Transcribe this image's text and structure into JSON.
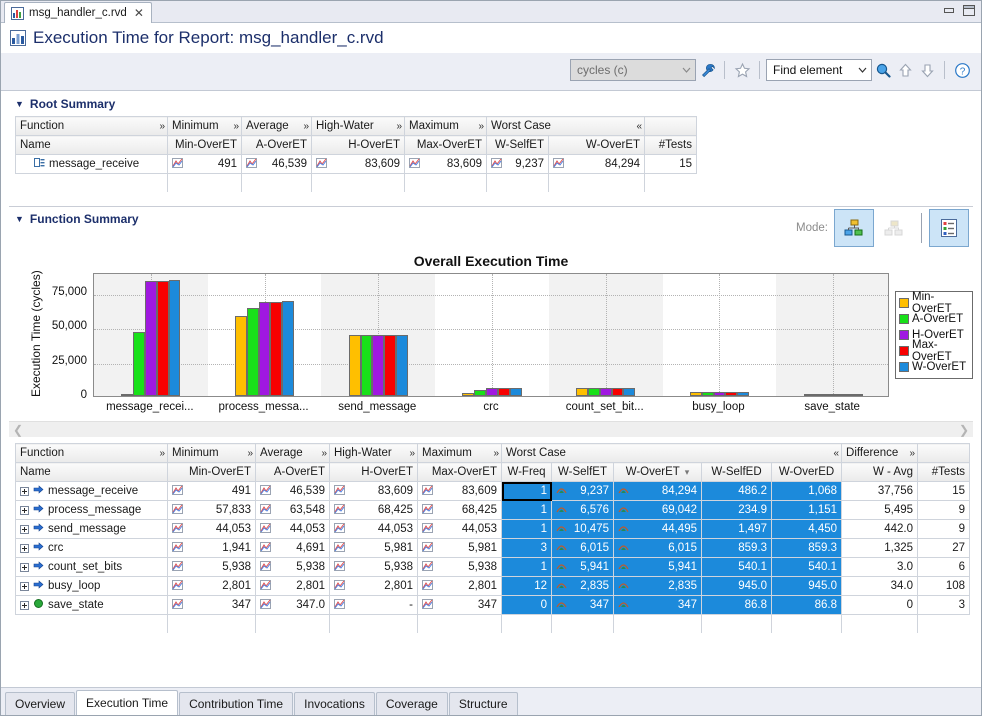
{
  "window": {
    "tab_title": "msg_handler_c.rvd",
    "tab_close": "✕",
    "minimize_label": "minimize",
    "maximize_label": "maximize"
  },
  "header": {
    "title": "Execution Time for Report: msg_handler_c.rvd"
  },
  "toolbar": {
    "units_value": "cycles (c)",
    "units_arrow": "⌄",
    "wrench_icon": "wrench-icon",
    "bookmark_icon": "bookmark-icon",
    "find_value": "Find element",
    "find_arrow": "⌄",
    "find_icon": "magnifier-icon",
    "up_arrow": "⇧",
    "down_arrow": "⇩",
    "help": "?"
  },
  "root_summary": {
    "twisty": "▼",
    "title": "Root Summary",
    "group_headers": [
      {
        "label": "Function",
        "chev": "»"
      },
      {
        "label": "Minimum",
        "chev": "»"
      },
      {
        "label": "Average",
        "chev": "»"
      },
      {
        "label": "High-Water",
        "chev": "»"
      },
      {
        "label": "Maximum",
        "chev": "»"
      },
      {
        "label": "Worst Case",
        "chev": "«"
      },
      {
        "label": "",
        "chev": ""
      }
    ],
    "columns": [
      "Name",
      "Min-OverET",
      "A-OverET",
      "H-OverET",
      "Max-OverET",
      "W-SelfET",
      "W-OverET",
      "#Tests"
    ],
    "rows": [
      {
        "name": "message_receive",
        "min_overet": "491",
        "a_overet": "46,539",
        "h_overet": "83,609",
        "max_overet": "83,609",
        "w_selfet": "9,237",
        "w_overet": "84,294",
        "tests": "15"
      }
    ]
  },
  "function_summary": {
    "twisty": "▼",
    "title": "Function Summary",
    "mode_label": "Mode:",
    "mode_buttons": [
      {
        "name": "tree-mode-button",
        "active": true
      },
      {
        "name": "flat-tree-mode-button",
        "active": false
      },
      {
        "name": "list-mode-button",
        "active": true
      }
    ],
    "scroll_left": "❮",
    "scroll_right": "❯"
  },
  "chart_data": {
    "type": "bar",
    "title": "Overall Execution Time",
    "xlabel": "",
    "ylabel": "Execution Time (cycles)",
    "ylim": [
      0,
      90000
    ],
    "yticks": [
      0,
      25000,
      50000,
      75000
    ],
    "ytick_labels": [
      "0",
      "25,000",
      "50,000",
      "75,000"
    ],
    "grid": true,
    "legend_position": "right",
    "categories": [
      "message_recei...",
      "process_messa...",
      "send_message",
      "crc",
      "count_set_bit...",
      "busy_loop",
      "save_state"
    ],
    "series": [
      {
        "name": "Min-OverET",
        "color": "#ffbf00",
        "values": [
          491,
          57833,
          44053,
          1941,
          5938,
          2801,
          347
        ]
      },
      {
        "name": "A-OverET",
        "color": "#18e019",
        "values": [
          46539,
          63548,
          44053,
          4691,
          5938,
          2801,
          347
        ]
      },
      {
        "name": "H-OverET",
        "color": "#a018e0",
        "values": [
          83609,
          68425,
          44053,
          5981,
          5938,
          2801,
          347
        ]
      },
      {
        "name": "Max-OverET",
        "color": "#f80000",
        "values": [
          83609,
          68425,
          44053,
          5981,
          5938,
          2801,
          347
        ]
      },
      {
        "name": "W-OverET",
        "color": "#1c8adb",
        "values": [
          84294,
          69042,
          44495,
          6015,
          5941,
          2835,
          347
        ]
      }
    ]
  },
  "function_table": {
    "group_headers": [
      {
        "label": "Function",
        "chev": "»"
      },
      {
        "label": "Minimum",
        "chev": "»"
      },
      {
        "label": "Average",
        "chev": "»"
      },
      {
        "label": "High-Water",
        "chev": "»"
      },
      {
        "label": "Maximum",
        "chev": "»"
      },
      {
        "label": "Worst Case",
        "chev": "«"
      },
      {
        "label": "Difference",
        "chev": "»"
      },
      {
        "label": "",
        "chev": ""
      }
    ],
    "columns": [
      "Name",
      "Min-OverET",
      "A-OverET",
      "H-OverET",
      "Max-OverET",
      "W-Freq",
      "W-SelfET",
      "W-OverET",
      "W-SelfED",
      "W-OverED",
      "W - Avg",
      "#Tests"
    ],
    "sort_column": "W-OverET",
    "sort_arrow": "▾",
    "rows": [
      {
        "name": "message_receive",
        "marker": "arrow",
        "min": "491",
        "avg": "46,539",
        "hw": "83,609",
        "max": "83,609",
        "wfreq": "1",
        "wselfet": "9,237",
        "woveret": "84,294",
        "wselfed": "486.2",
        "wovered": "1,068",
        "wavg": "37,756",
        "tests": "15"
      },
      {
        "name": "process_message",
        "marker": "arrow",
        "min": "57,833",
        "avg": "63,548",
        "hw": "68,425",
        "max": "68,425",
        "wfreq": "1",
        "wselfet": "6,576",
        "woveret": "69,042",
        "wselfed": "234.9",
        "wovered": "1,151",
        "wavg": "5,495",
        "tests": "9"
      },
      {
        "name": "send_message",
        "marker": "arrow",
        "min": "44,053",
        "avg": "44,053",
        "hw": "44,053",
        "max": "44,053",
        "wfreq": "1",
        "wselfet": "10,475",
        "woveret": "44,495",
        "wselfed": "1,497",
        "wovered": "4,450",
        "wavg": "442.0",
        "tests": "9"
      },
      {
        "name": "crc",
        "marker": "arrow",
        "min": "1,941",
        "avg": "4,691",
        "hw": "5,981",
        "max": "5,981",
        "wfreq": "3",
        "wselfet": "6,015",
        "woveret": "6,015",
        "wselfed": "859.3",
        "wovered": "859.3",
        "wavg": "1,325",
        "tests": "27"
      },
      {
        "name": "count_set_bits",
        "marker": "arrow",
        "min": "5,938",
        "avg": "5,938",
        "hw": "5,938",
        "max": "5,938",
        "wfreq": "1",
        "wselfet": "5,941",
        "woveret": "5,941",
        "wselfed": "540.1",
        "wovered": "540.1",
        "wavg": "3.0",
        "tests": "6"
      },
      {
        "name": "busy_loop",
        "marker": "arrow",
        "min": "2,801",
        "avg": "2,801",
        "hw": "2,801",
        "max": "2,801",
        "wfreq": "12",
        "wselfet": "2,835",
        "woveret": "2,835",
        "wselfed": "945.0",
        "wovered": "945.0",
        "wavg": "34.0",
        "tests": "108"
      },
      {
        "name": "save_state",
        "marker": "circle",
        "min": "347",
        "avg": "347.0",
        "hw": "-",
        "max": "347",
        "wfreq": "0",
        "wselfet": "347",
        "woveret": "347",
        "wselfed": "86.8",
        "wovered": "86.8",
        "wavg": "0",
        "tests": "3"
      }
    ]
  },
  "bottom_tabs": [
    {
      "label": "Overview",
      "active": false
    },
    {
      "label": "Execution Time",
      "active": true
    },
    {
      "label": "Contribution Time",
      "active": false
    },
    {
      "label": "Invocations",
      "active": false
    },
    {
      "label": "Coverage",
      "active": false
    },
    {
      "label": "Structure",
      "active": false
    }
  ]
}
